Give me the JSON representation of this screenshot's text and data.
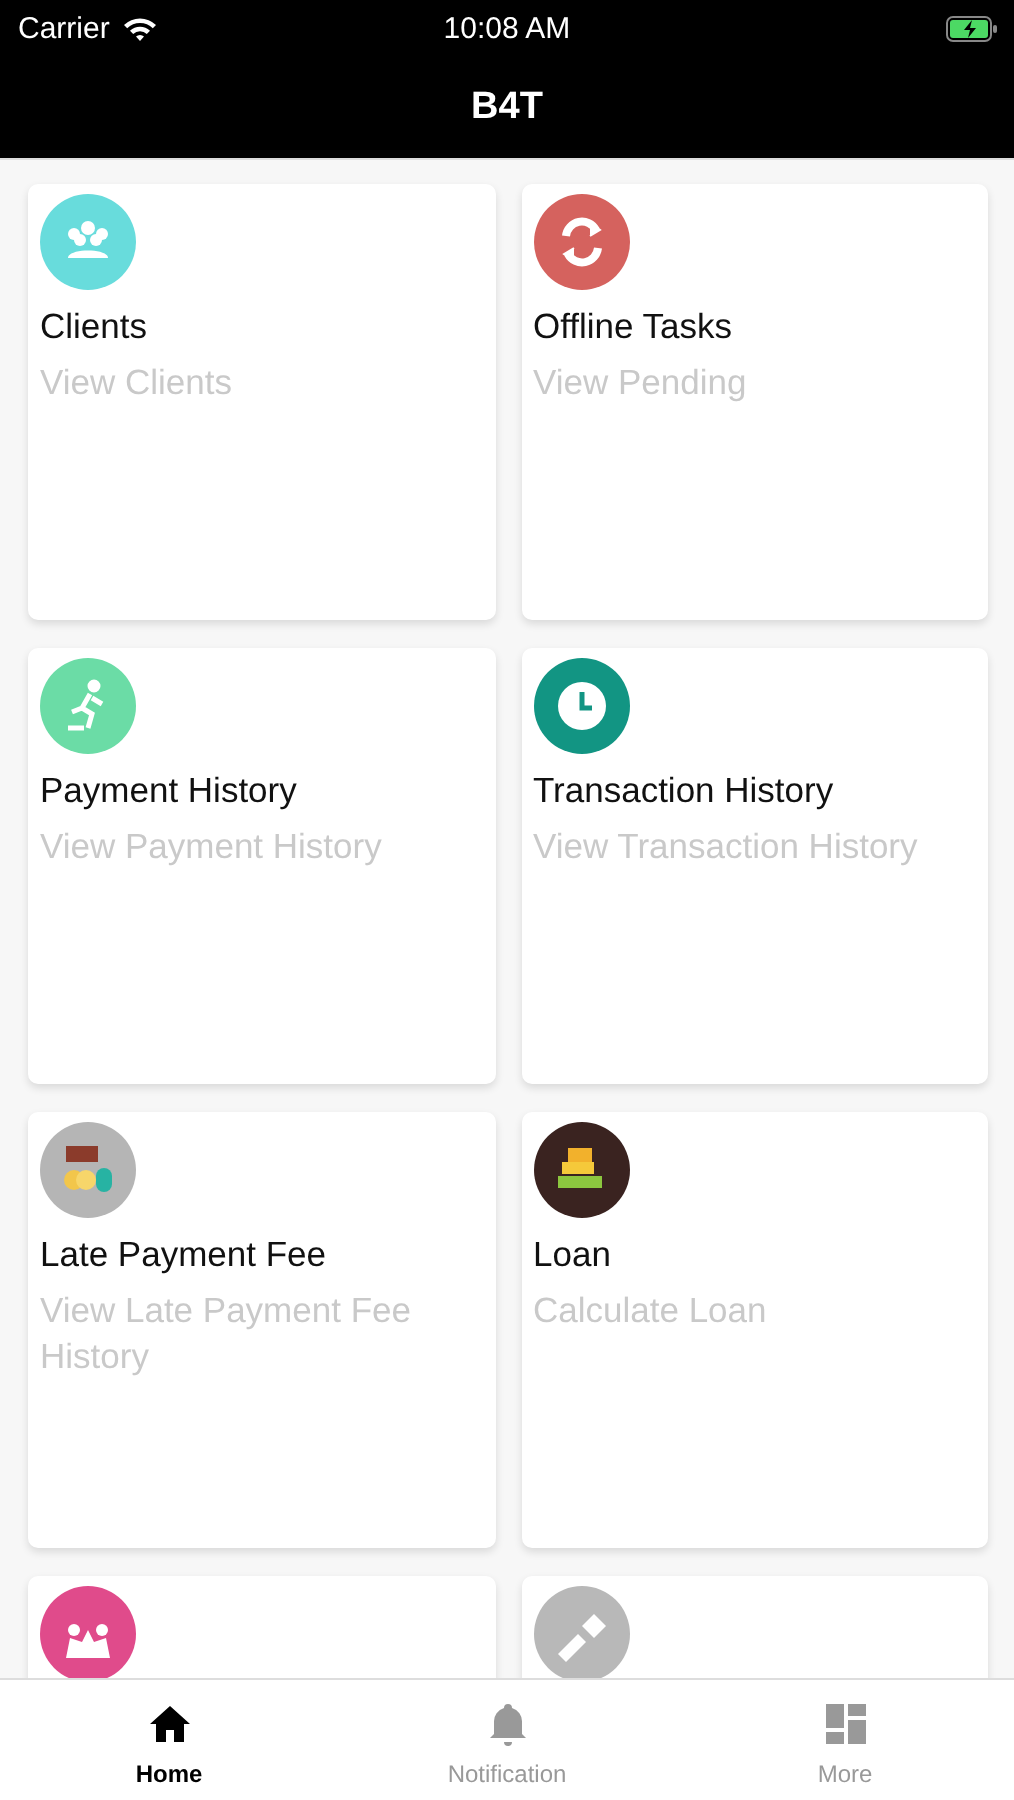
{
  "status_bar": {
    "carrier": "Carrier",
    "time": "10:08 AM"
  },
  "nav_bar": {
    "title": "B4T"
  },
  "cards": [
    {
      "title": "Clients",
      "subtitle": "View Clients",
      "color": "#68dcdc"
    },
    {
      "title": "Offline Tasks",
      "subtitle": "View Pending",
      "color": "#d5625e"
    },
    {
      "title": "Payment History",
      "subtitle": "View Payment History",
      "color": "#6bdca6"
    },
    {
      "title": "Transaction History",
      "subtitle": "View Transaction History",
      "color": "#129583"
    },
    {
      "title": "Late Payment Fee",
      "subtitle": "View Late Payment Fee History",
      "color": "#b5b5b5"
    },
    {
      "title": "Loan",
      "subtitle": "Calculate Loan",
      "color": "#3a2320"
    },
    {
      "color": "#e04b8b"
    },
    {
      "color": "#b8b8b8"
    }
  ],
  "tab_bar": [
    {
      "label": "Home",
      "selected": true
    },
    {
      "label": "Notification",
      "selected": false
    },
    {
      "label": "More",
      "selected": false
    }
  ]
}
